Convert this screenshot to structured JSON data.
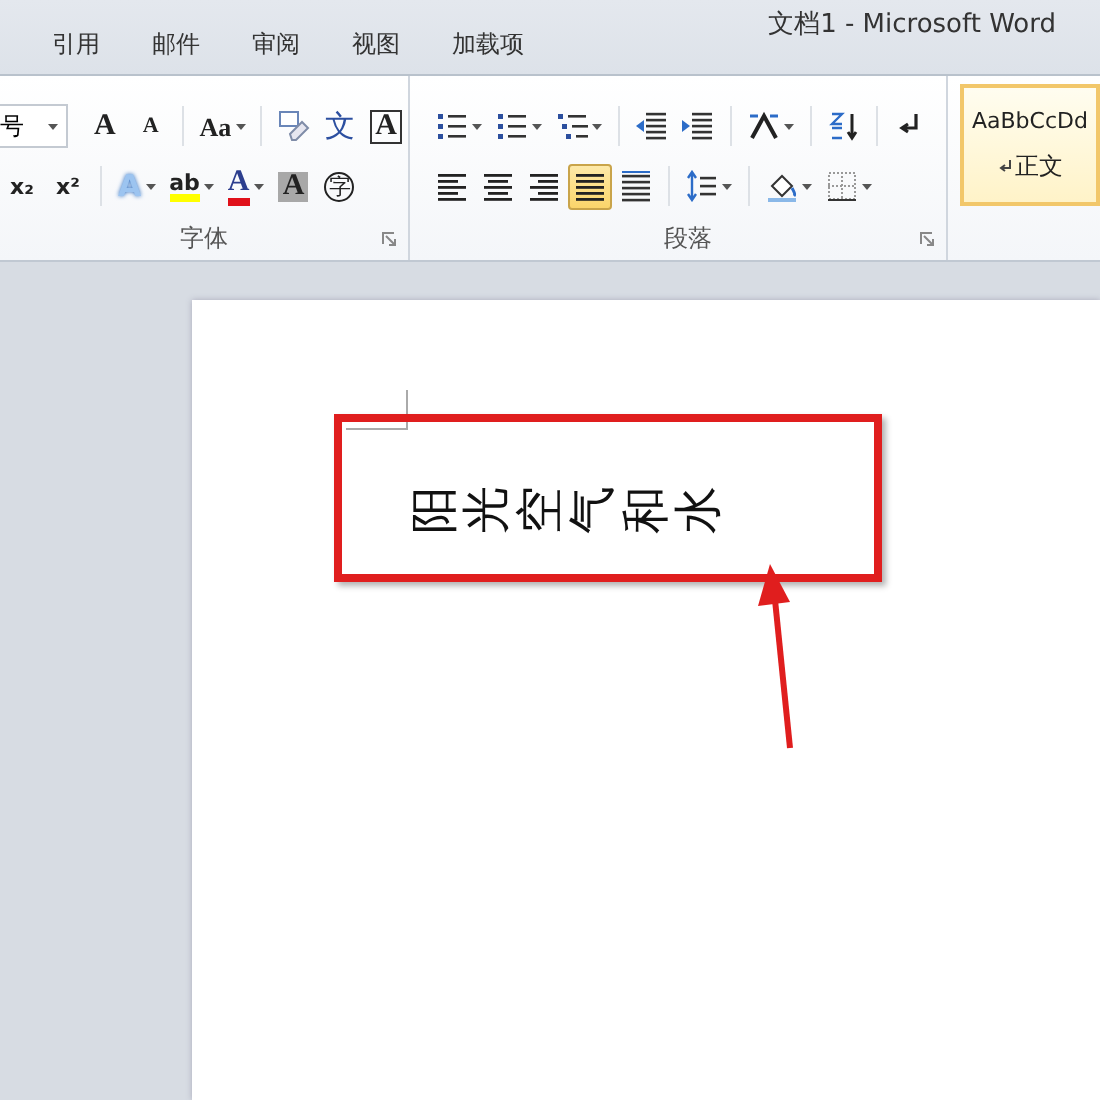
{
  "window": {
    "title": "文档1  -  Microsoft Word"
  },
  "tabs": [
    {
      "label": "引用",
      "selected": false
    },
    {
      "label": "邮件",
      "selected": false
    },
    {
      "label": "审阅",
      "selected": false
    },
    {
      "label": "视图",
      "selected": false
    },
    {
      "label": "加载项",
      "selected": false
    }
  ],
  "ribbon": {
    "groups": [
      {
        "label": "字体",
        "launcher": true,
        "rows": [
          [
            {
              "kind": "size-field",
              "value": "号"
            },
            {
              "kind": "grow",
              "text": "A"
            },
            {
              "kind": "shrink",
              "text": "A"
            },
            {
              "kind": "sep"
            },
            {
              "kind": "case",
              "text": "Aa",
              "dropdown": true
            },
            {
              "kind": "sep"
            },
            {
              "kind": "clear"
            },
            {
              "kind": "phonetic",
              "text": "文"
            },
            {
              "kind": "border-char",
              "text": "A"
            }
          ],
          [
            {
              "kind": "sub",
              "text": "x₂"
            },
            {
              "kind": "sup",
              "text": "x²"
            },
            {
              "kind": "sep"
            },
            {
              "kind": "effects",
              "text": "A",
              "dropdown": true
            },
            {
              "kind": "highlight",
              "text": "ab",
              "dropdown": true
            },
            {
              "kind": "fontcolor",
              "text": "A",
              "dropdown": true
            },
            {
              "kind": "shade-char",
              "text": "A"
            },
            {
              "kind": "enclose",
              "text": "字"
            }
          ]
        ]
      },
      {
        "label": "段落",
        "launcher": true,
        "rows": [
          [
            {
              "kind": "bullets",
              "dropdown": true
            },
            {
              "kind": "numbering",
              "dropdown": true
            },
            {
              "kind": "multilevel",
              "dropdown": true
            },
            {
              "kind": "sep"
            },
            {
              "kind": "outdent"
            },
            {
              "kind": "indent"
            },
            {
              "kind": "sep"
            },
            {
              "kind": "direction",
              "dropdown": true
            },
            {
              "kind": "sep"
            },
            {
              "kind": "sort"
            },
            {
              "kind": "sep"
            },
            {
              "kind": "marks"
            }
          ],
          [
            {
              "kind": "align-left",
              "selected": false
            },
            {
              "kind": "align-center",
              "selected": false
            },
            {
              "kind": "align-right",
              "selected": false
            },
            {
              "kind": "justify",
              "selected": true
            },
            {
              "kind": "distribute",
              "selected": false
            },
            {
              "kind": "sep"
            },
            {
              "kind": "spacing",
              "dropdown": true
            },
            {
              "kind": "sep"
            },
            {
              "kind": "fill",
              "dropdown": true
            },
            {
              "kind": "borders",
              "dropdown": true
            }
          ]
        ]
      }
    ],
    "styles": [
      {
        "sample": "AaBbCcDd",
        "name": "正文",
        "selected": true
      }
    ]
  },
  "document": {
    "text": "阳光空气和水"
  }
}
